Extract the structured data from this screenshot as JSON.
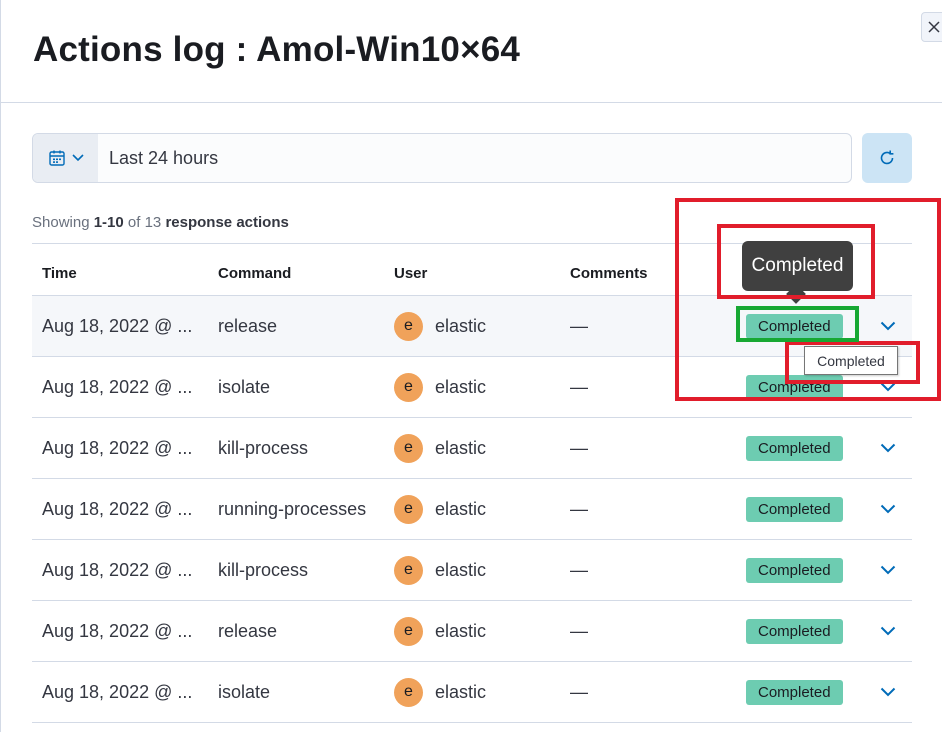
{
  "flyout": {
    "title": "Actions log : Amol-Win10×64",
    "close_icon": "close-icon"
  },
  "filters": {
    "calendar_icon": "calendar-icon",
    "chevron_icon": "chevron-down-icon",
    "date_range": "Last 24 hours",
    "refresh_icon": "refresh-icon"
  },
  "count": {
    "prefix": "Showing ",
    "range": "1-10",
    "middle": " of 13 ",
    "suffix": "response actions"
  },
  "table": {
    "headers": {
      "time": "Time",
      "command": "Command",
      "user": "User",
      "comments": "Comments"
    },
    "rows": [
      {
        "time": "Aug 18, 2022 @ ...",
        "command": "release",
        "avatar": "e",
        "user": "elastic",
        "comments": "—",
        "status": "Completed"
      },
      {
        "time": "Aug 18, 2022 @ ...",
        "command": "isolate",
        "avatar": "e",
        "user": "elastic",
        "comments": "—",
        "status": "Completed"
      },
      {
        "time": "Aug 18, 2022 @ ...",
        "command": "kill-process",
        "avatar": "e",
        "user": "elastic",
        "comments": "—",
        "status": "Completed"
      },
      {
        "time": "Aug 18, 2022 @ ...",
        "command": "running-processes",
        "avatar": "e",
        "user": "elastic",
        "comments": "—",
        "status": "Completed"
      },
      {
        "time": "Aug 18, 2022 @ ...",
        "command": "kill-process",
        "avatar": "e",
        "user": "elastic",
        "comments": "—",
        "status": "Completed"
      },
      {
        "time": "Aug 18, 2022 @ ...",
        "command": "release",
        "avatar": "e",
        "user": "elastic",
        "comments": "—",
        "status": "Completed"
      },
      {
        "time": "Aug 18, 2022 @ ...",
        "command": "isolate",
        "avatar": "e",
        "user": "elastic",
        "comments": "—",
        "status": "Completed"
      }
    ]
  },
  "tooltip": {
    "text": "Completed"
  },
  "native_tooltip": {
    "text": "Completed"
  },
  "colors": {
    "badge_success": "#6dccb1",
    "avatar": "#f0a25a",
    "annotation_red": "#e11d2b",
    "annotation_green": "#17a833",
    "tooltip_bg": "#404040"
  }
}
